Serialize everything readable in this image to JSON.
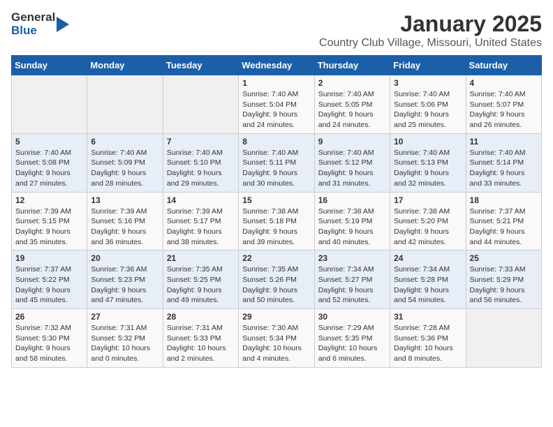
{
  "header": {
    "logo_general": "General",
    "logo_blue": "Blue",
    "month_title": "January 2025",
    "location": "Country Club Village, Missouri, United States"
  },
  "days_of_week": [
    "Sunday",
    "Monday",
    "Tuesday",
    "Wednesday",
    "Thursday",
    "Friday",
    "Saturday"
  ],
  "weeks": [
    [
      {
        "day": "",
        "info": ""
      },
      {
        "day": "",
        "info": ""
      },
      {
        "day": "",
        "info": ""
      },
      {
        "day": "1",
        "info": "Sunrise: 7:40 AM\nSunset: 5:04 PM\nDaylight: 9 hours\nand 24 minutes."
      },
      {
        "day": "2",
        "info": "Sunrise: 7:40 AM\nSunset: 5:05 PM\nDaylight: 9 hours\nand 24 minutes."
      },
      {
        "day": "3",
        "info": "Sunrise: 7:40 AM\nSunset: 5:06 PM\nDaylight: 9 hours\nand 25 minutes."
      },
      {
        "day": "4",
        "info": "Sunrise: 7:40 AM\nSunset: 5:07 PM\nDaylight: 9 hours\nand 26 minutes."
      }
    ],
    [
      {
        "day": "5",
        "info": "Sunrise: 7:40 AM\nSunset: 5:08 PM\nDaylight: 9 hours\nand 27 minutes."
      },
      {
        "day": "6",
        "info": "Sunrise: 7:40 AM\nSunset: 5:09 PM\nDaylight: 9 hours\nand 28 minutes."
      },
      {
        "day": "7",
        "info": "Sunrise: 7:40 AM\nSunset: 5:10 PM\nDaylight: 9 hours\nand 29 minutes."
      },
      {
        "day": "8",
        "info": "Sunrise: 7:40 AM\nSunset: 5:11 PM\nDaylight: 9 hours\nand 30 minutes."
      },
      {
        "day": "9",
        "info": "Sunrise: 7:40 AM\nSunset: 5:12 PM\nDaylight: 9 hours\nand 31 minutes."
      },
      {
        "day": "10",
        "info": "Sunrise: 7:40 AM\nSunset: 5:13 PM\nDaylight: 9 hours\nand 32 minutes."
      },
      {
        "day": "11",
        "info": "Sunrise: 7:40 AM\nSunset: 5:14 PM\nDaylight: 9 hours\nand 33 minutes."
      }
    ],
    [
      {
        "day": "12",
        "info": "Sunrise: 7:39 AM\nSunset: 5:15 PM\nDaylight: 9 hours\nand 35 minutes."
      },
      {
        "day": "13",
        "info": "Sunrise: 7:39 AM\nSunset: 5:16 PM\nDaylight: 9 hours\nand 36 minutes."
      },
      {
        "day": "14",
        "info": "Sunrise: 7:39 AM\nSunset: 5:17 PM\nDaylight: 9 hours\nand 38 minutes."
      },
      {
        "day": "15",
        "info": "Sunrise: 7:38 AM\nSunset: 5:18 PM\nDaylight: 9 hours\nand 39 minutes."
      },
      {
        "day": "16",
        "info": "Sunrise: 7:38 AM\nSunset: 5:19 PM\nDaylight: 9 hours\nand 40 minutes."
      },
      {
        "day": "17",
        "info": "Sunrise: 7:38 AM\nSunset: 5:20 PM\nDaylight: 9 hours\nand 42 minutes."
      },
      {
        "day": "18",
        "info": "Sunrise: 7:37 AM\nSunset: 5:21 PM\nDaylight: 9 hours\nand 44 minutes."
      }
    ],
    [
      {
        "day": "19",
        "info": "Sunrise: 7:37 AM\nSunset: 5:22 PM\nDaylight: 9 hours\nand 45 minutes."
      },
      {
        "day": "20",
        "info": "Sunrise: 7:36 AM\nSunset: 5:23 PM\nDaylight: 9 hours\nand 47 minutes."
      },
      {
        "day": "21",
        "info": "Sunrise: 7:35 AM\nSunset: 5:25 PM\nDaylight: 9 hours\nand 49 minutes."
      },
      {
        "day": "22",
        "info": "Sunrise: 7:35 AM\nSunset: 5:26 PM\nDaylight: 9 hours\nand 50 minutes."
      },
      {
        "day": "23",
        "info": "Sunrise: 7:34 AM\nSunset: 5:27 PM\nDaylight: 9 hours\nand 52 minutes."
      },
      {
        "day": "24",
        "info": "Sunrise: 7:34 AM\nSunset: 5:28 PM\nDaylight: 9 hours\nand 54 minutes."
      },
      {
        "day": "25",
        "info": "Sunrise: 7:33 AM\nSunset: 5:29 PM\nDaylight: 9 hours\nand 56 minutes."
      }
    ],
    [
      {
        "day": "26",
        "info": "Sunrise: 7:32 AM\nSunset: 5:30 PM\nDaylight: 9 hours\nand 58 minutes."
      },
      {
        "day": "27",
        "info": "Sunrise: 7:31 AM\nSunset: 5:32 PM\nDaylight: 10 hours\nand 0 minutes."
      },
      {
        "day": "28",
        "info": "Sunrise: 7:31 AM\nSunset: 5:33 PM\nDaylight: 10 hours\nand 2 minutes."
      },
      {
        "day": "29",
        "info": "Sunrise: 7:30 AM\nSunset: 5:34 PM\nDaylight: 10 hours\nand 4 minutes."
      },
      {
        "day": "30",
        "info": "Sunrise: 7:29 AM\nSunset: 5:35 PM\nDaylight: 10 hours\nand 6 minutes."
      },
      {
        "day": "31",
        "info": "Sunrise: 7:28 AM\nSunset: 5:36 PM\nDaylight: 10 hours\nand 8 minutes."
      },
      {
        "day": "",
        "info": ""
      }
    ]
  ]
}
